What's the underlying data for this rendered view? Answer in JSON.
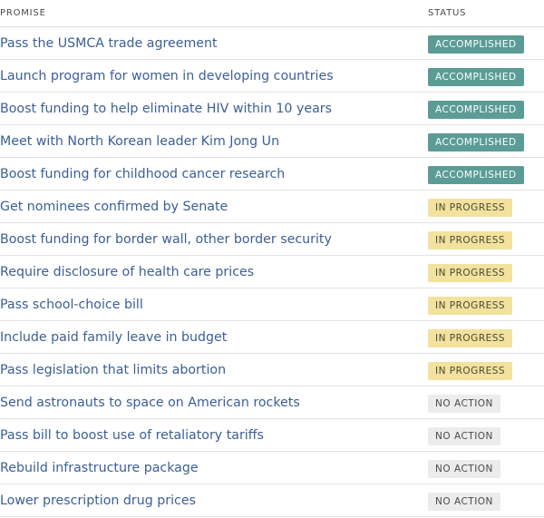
{
  "header": {
    "promise_label": "PROMISE",
    "status_label": "STATUS"
  },
  "colors": {
    "link": "#3b5e95",
    "accomplished": "#5b9c96",
    "in_progress": "#f2e29d",
    "no_action": "#ececec"
  },
  "rows": [
    {
      "promise": "Pass the USMCA trade agreement",
      "status": "ACCOMPLISHED",
      "kind": "accomplished"
    },
    {
      "promise": "Launch program for women in developing countries",
      "status": "ACCOMPLISHED",
      "kind": "accomplished"
    },
    {
      "promise": "Boost funding to help eliminate HIV within 10 years",
      "status": "ACCOMPLISHED",
      "kind": "accomplished"
    },
    {
      "promise": "Meet with North Korean leader Kim Jong Un",
      "status": "ACCOMPLISHED",
      "kind": "accomplished"
    },
    {
      "promise": "Boost funding for childhood cancer research",
      "status": "ACCOMPLISHED",
      "kind": "accomplished"
    },
    {
      "promise": "Get nominees confirmed by Senate",
      "status": "IN PROGRESS",
      "kind": "progress"
    },
    {
      "promise": "Boost funding for border wall, other border security",
      "status": "IN PROGRESS",
      "kind": "progress"
    },
    {
      "promise": "Require disclosure of health care prices",
      "status": "IN PROGRESS",
      "kind": "progress"
    },
    {
      "promise": "Pass school-choice bill",
      "status": "IN PROGRESS",
      "kind": "progress"
    },
    {
      "promise": "Include paid family leave in budget",
      "status": "IN PROGRESS",
      "kind": "progress"
    },
    {
      "promise": "Pass legislation that limits abortion",
      "status": "IN PROGRESS",
      "kind": "progress"
    },
    {
      "promise": "Send astronauts to space on American rockets",
      "status": "NO ACTION",
      "kind": "noaction"
    },
    {
      "promise": "Pass bill to boost use of retaliatory tariffs",
      "status": "NO ACTION",
      "kind": "noaction"
    },
    {
      "promise": "Rebuild infrastructure package",
      "status": "NO ACTION",
      "kind": "noaction"
    },
    {
      "promise": "Lower prescription drug prices",
      "status": "NO ACTION",
      "kind": "noaction"
    }
  ]
}
